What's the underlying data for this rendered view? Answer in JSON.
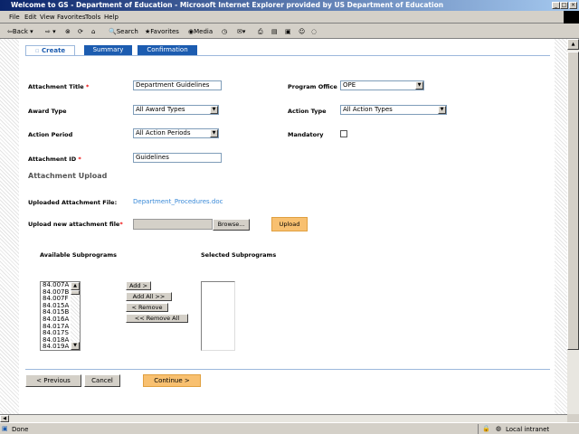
{
  "window": {
    "title": "Welcome to GS - Department of Education - Microsoft Internet Explorer provided by US Department of Education"
  },
  "menu": [
    "File",
    "Edit",
    "View",
    "Favorites",
    "Tools",
    "Help"
  ],
  "toolbar": {
    "back": "Back",
    "search": "Search",
    "favorites": "Favorites",
    "media": "Media"
  },
  "tabs": [
    {
      "label": "Create",
      "active": true
    },
    {
      "label": "Summary"
    },
    {
      "label": "Confirmation"
    }
  ],
  "form": {
    "attachment_title": {
      "label": "Attachment Title",
      "value": "Department Guidelines"
    },
    "program_office": {
      "label": "Program Office",
      "value": "OPE"
    },
    "award_type": {
      "label": "Award Type",
      "value": "All Award Types"
    },
    "action_type": {
      "label": "Action Type",
      "value": "All Action Types"
    },
    "action_period": {
      "label": "Action Period",
      "value": "All Action Periods"
    },
    "mandatory": {
      "label": "Mandatory",
      "checked": false
    },
    "attachment_id": {
      "label": "Attachment ID",
      "value": "Guidelines"
    },
    "required_mark": "*"
  },
  "upload": {
    "heading": "Attachment Upload",
    "uploaded_label": "Uploaded Attachment File:",
    "uploaded_file": "Department_Procedures.doc",
    "new_label": "Upload new attachment file",
    "browse": "Browse...",
    "upload": "Upload"
  },
  "subprograms": {
    "available_label": "Available Subprograms",
    "selected_label": "Selected Subprograms",
    "available": [
      "84.007A",
      "84.007B",
      "84.007F",
      "84.015A",
      "84.015B",
      "84.016A",
      "84.017A",
      "84.017S",
      "84.018A",
      "84.019A"
    ],
    "add": "Add >",
    "add_all": "Add All >>",
    "remove": "< Remove",
    "remove_all": "<< Remove All"
  },
  "nav": {
    "previous": "< Previous",
    "cancel": "Cancel",
    "continue": "Continue >"
  },
  "status": {
    "text": "Done",
    "zone": "Local intranet"
  },
  "colors": {
    "tab": "#1c5cb0",
    "accent_button": "#f8c070",
    "link": "#3a8ad8"
  }
}
